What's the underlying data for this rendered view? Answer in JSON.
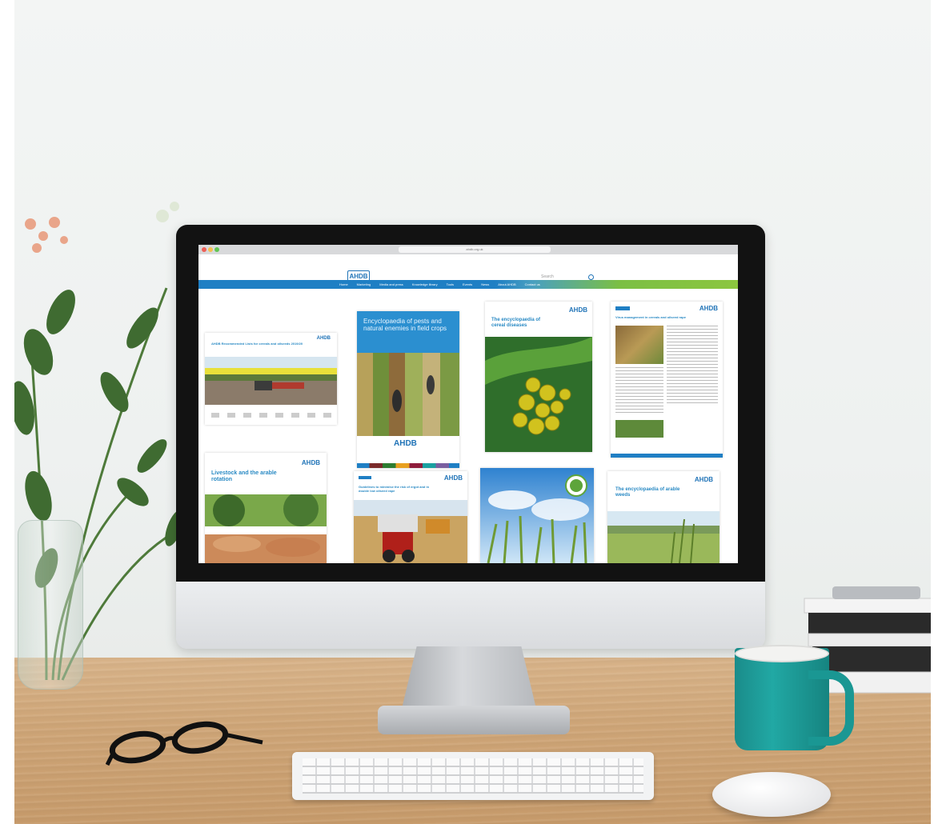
{
  "browser": {
    "url": "ahdb.org.uk"
  },
  "site": {
    "logo": "AHDB",
    "search_placeholder": "Search",
    "nav": [
      "Home",
      "Marketing",
      "Media and press",
      "Knowledge library",
      "Tools",
      "Events",
      "News",
      "About AHDB",
      "Contact us"
    ]
  },
  "publications": [
    {
      "title": "AHDB Recommended Lists for cereals and oilseeds 2019/20",
      "tag": "AHDB"
    },
    {
      "title": "Encyclopaedia of pests and natural enemies in field crops",
      "tag": "AHDB"
    },
    {
      "title": "The encyclopaedia of cereal diseases",
      "tag": "AHDB"
    },
    {
      "title": "Virus management in cereals and oilseed rape",
      "tag": "AHDB"
    },
    {
      "title": "Livestock and the arable rotation",
      "tag": "AHDB"
    },
    {
      "title": "Guidelines to minimise the risk of ergot and in double low oilseed rape",
      "tag": "AHDB"
    },
    {
      "title": "",
      "tag": ""
    },
    {
      "title": "The encyclopaedia of arable weeds",
      "tag": "AHDB"
    }
  ],
  "colors": {
    "brand_blue": "#1f73b7",
    "brand_green": "#8cc63f",
    "mug_teal": "#21a8a4"
  }
}
